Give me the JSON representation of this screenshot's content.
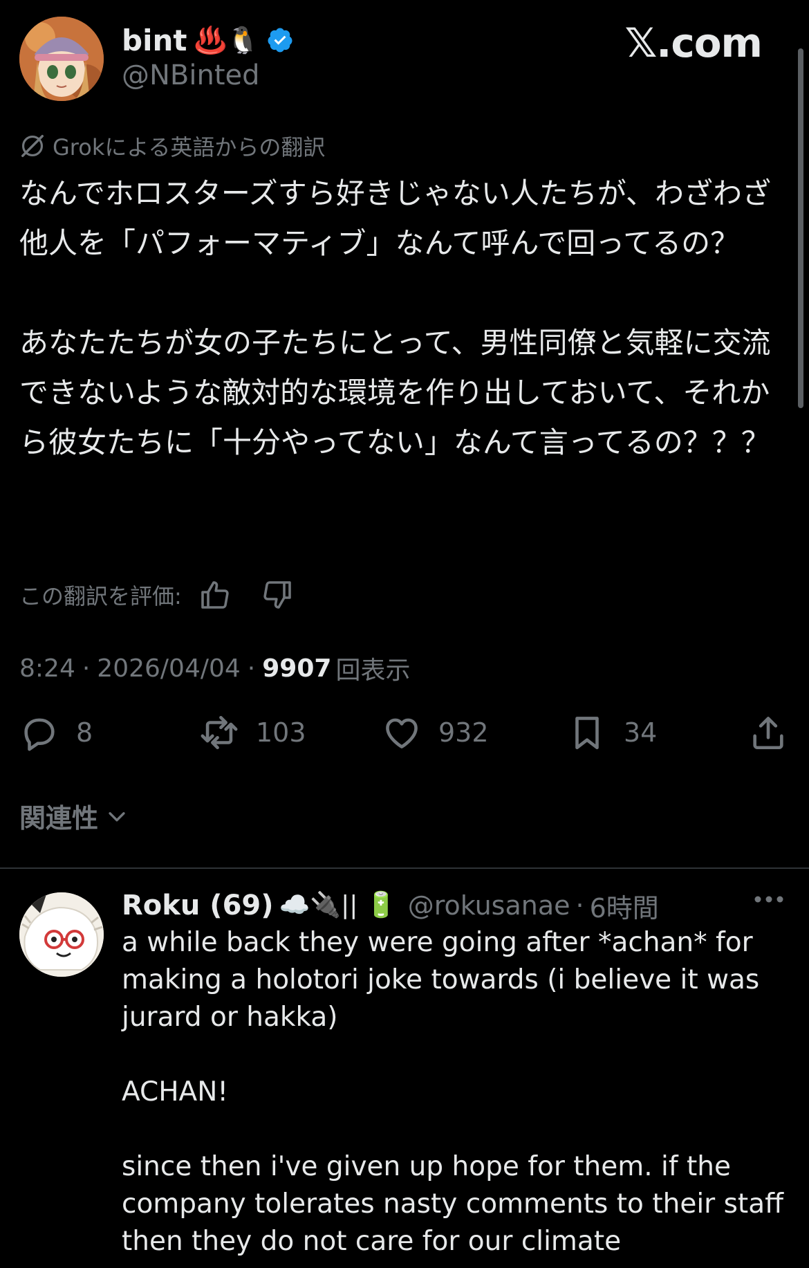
{
  "header": {
    "display_name": "bint",
    "name_emojis": "♨️🐧",
    "handle": "@NBinted",
    "brand": "𝕏.com"
  },
  "translation": {
    "note": "Grokによる英語からの翻訳",
    "rate_label": "この翻訳を評価:"
  },
  "tweet": {
    "text": "なんでホロスターズすら好きじゃない人たちが、わざわざ他人を「パフォーマティブ」なんて呼んで回ってるの？\n\nあなたたちが女の子たちにとって、男性同僚と気軽に交流できないような敵対的な環境を作り出しておいて、それから彼女たちに「十分やってない」なんて言ってるの？？？",
    "time": "8:24",
    "date": "2026/04/04",
    "separator": "·",
    "views_count": "9907",
    "views_label": "回表示"
  },
  "actions": {
    "replies": "8",
    "reposts": "103",
    "likes": "932",
    "bookmarks": "34"
  },
  "sort": {
    "label": "関連性"
  },
  "reply": {
    "display_name": "Roku (69)",
    "name_emojis": "☁️🔌|| 🔋",
    "handle": "@rokusanae",
    "time": "6時間",
    "separator": "·",
    "text": "a while back they were going after *achan* for making a holotori joke towards (i believe it was jurard or hakka)\n\nACHAN!\n\nsince then i've given up hope for them. if the company tolerates nasty comments to their staff then they do not care for our climate"
  },
  "colors": {
    "background": "#000000",
    "text": "#e7e9ea",
    "muted": "#71767b",
    "verified": "#1d9bf0",
    "divider": "#2f3336"
  }
}
